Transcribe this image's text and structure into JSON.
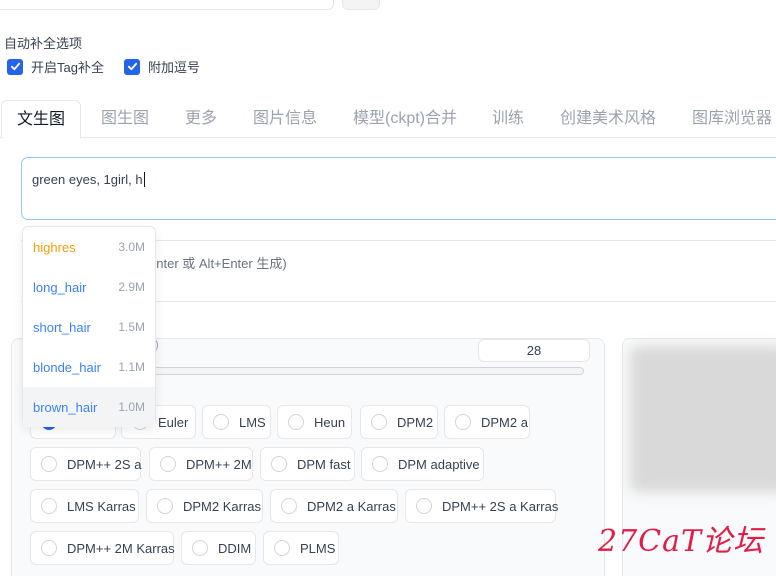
{
  "autocomplete": {
    "title": "自动补全选项",
    "option_tag": "开启Tag补全",
    "option_comma": "附加逗号"
  },
  "tabs": [
    {
      "label": "文生图",
      "selected": true
    },
    {
      "label": "图生图"
    },
    {
      "label": "更多"
    },
    {
      "label": "图片信息"
    },
    {
      "label": "模型(ckpt)合并"
    },
    {
      "label": "训练"
    },
    {
      "label": "创建美术风格"
    },
    {
      "label": "图库浏览器"
    }
  ],
  "prompt": {
    "value": "green eyes, 1girl, h"
  },
  "negative_hint": "+Enter 或 Alt+Enter 生成)",
  "steps": {
    "value": "28",
    "label_fragment": ")"
  },
  "suggestions": [
    {
      "name": "highres",
      "count": "3.0M"
    },
    {
      "name": "long_hair",
      "count": "2.9M"
    },
    {
      "name": "short_hair",
      "count": "1.5M"
    },
    {
      "name": "blonde_hair",
      "count": "1.1M"
    },
    {
      "name": "brown_hair",
      "count": "1.0M"
    }
  ],
  "samplers": [
    {
      "label": "Euler"
    },
    {
      "label": "LMS"
    },
    {
      "label": "Heun"
    },
    {
      "label": "DPM2"
    },
    {
      "label": "DPM2 a"
    },
    {
      "label": "DPM++ 2S a"
    },
    {
      "label": "DPM++ 2M"
    },
    {
      "label": "DPM fast"
    },
    {
      "label": "DPM adaptive"
    },
    {
      "label": "LMS Karras"
    },
    {
      "label": "DPM2 Karras"
    },
    {
      "label": "DPM2 a Karras"
    },
    {
      "label": "DPM++ 2S a Karras"
    },
    {
      "label": "DPM++ 2M Karras"
    },
    {
      "label": "DDIM"
    },
    {
      "label": "PLMS"
    }
  ],
  "watermark": "27CaT论坛",
  "colors": {
    "accent": "#2563eb",
    "suggestion_link": "#3b82f6",
    "suggestion_top": "#f59e0b",
    "watermark": "#e11d48"
  }
}
